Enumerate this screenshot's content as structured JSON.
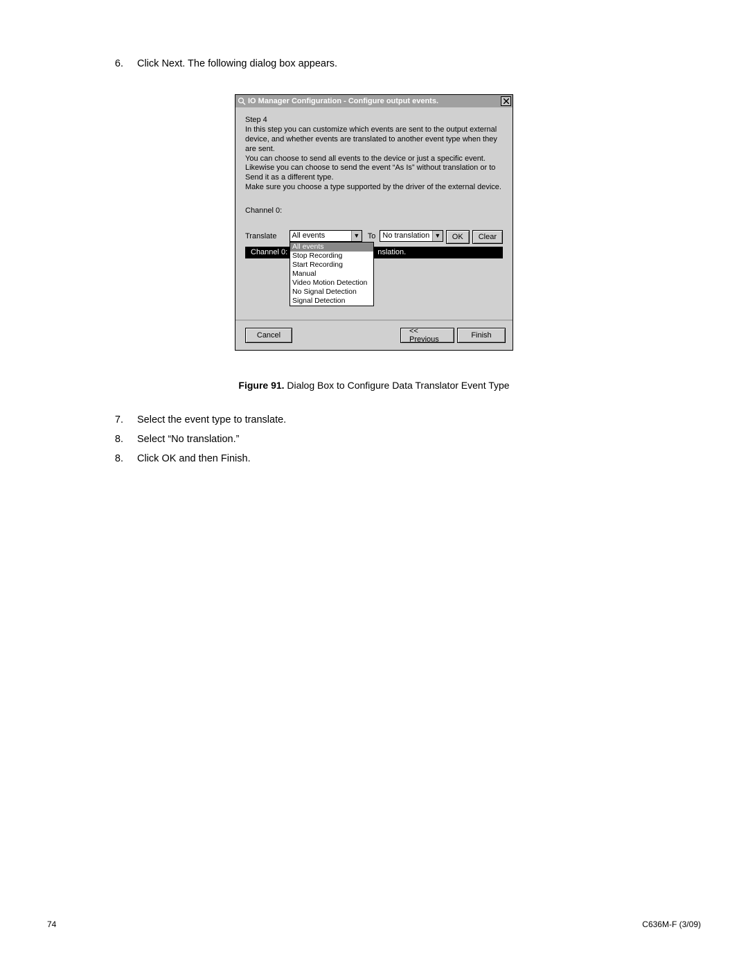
{
  "steps": {
    "s6": {
      "num": "6.",
      "text": "Click Next. The following dialog box appears."
    },
    "s7": {
      "num": "7.",
      "text": "Select the event type to translate."
    },
    "s8a": {
      "num": "8.",
      "text": "Select “No translation.”"
    },
    "s8b": {
      "num": "8.",
      "text": "Click OK and then Finish."
    }
  },
  "dialog": {
    "title": "IO Manager Configuration - Configure output events.",
    "step_heading": "Step 4",
    "description": "In this step you can customize which events are sent to the output external device, and whether events are translated to another event type when they are sent.\nYou can choose to send all events to the device or just a specific event. Likewise you can choose to send the event “As Is” without translation or to Send it as a different type.\nMake sure you choose a type supported by the driver of the external device.",
    "channel_label": "Channel 0:",
    "translate_label": "Translate",
    "to_label": "To",
    "translate_value": "All events",
    "to_value": "No translation",
    "dropdown_options": [
      "All events",
      "Stop Recording",
      "Start Recording",
      "Manual",
      "Video Motion Detection",
      "No Signal Detection",
      "Signal Detection"
    ],
    "banner_left": "Channel 0:",
    "banner_right": "nslation.",
    "buttons": {
      "ok": "OK",
      "clear": "Clear",
      "cancel": "Cancel",
      "previous": "<< Previous",
      "finish": "Finish"
    }
  },
  "caption": {
    "label": "Figure 91.",
    "text": "  Dialog Box to Configure Data Translator Event Type"
  },
  "footer": {
    "page": "74",
    "doc": "C636M-F (3/09)"
  }
}
